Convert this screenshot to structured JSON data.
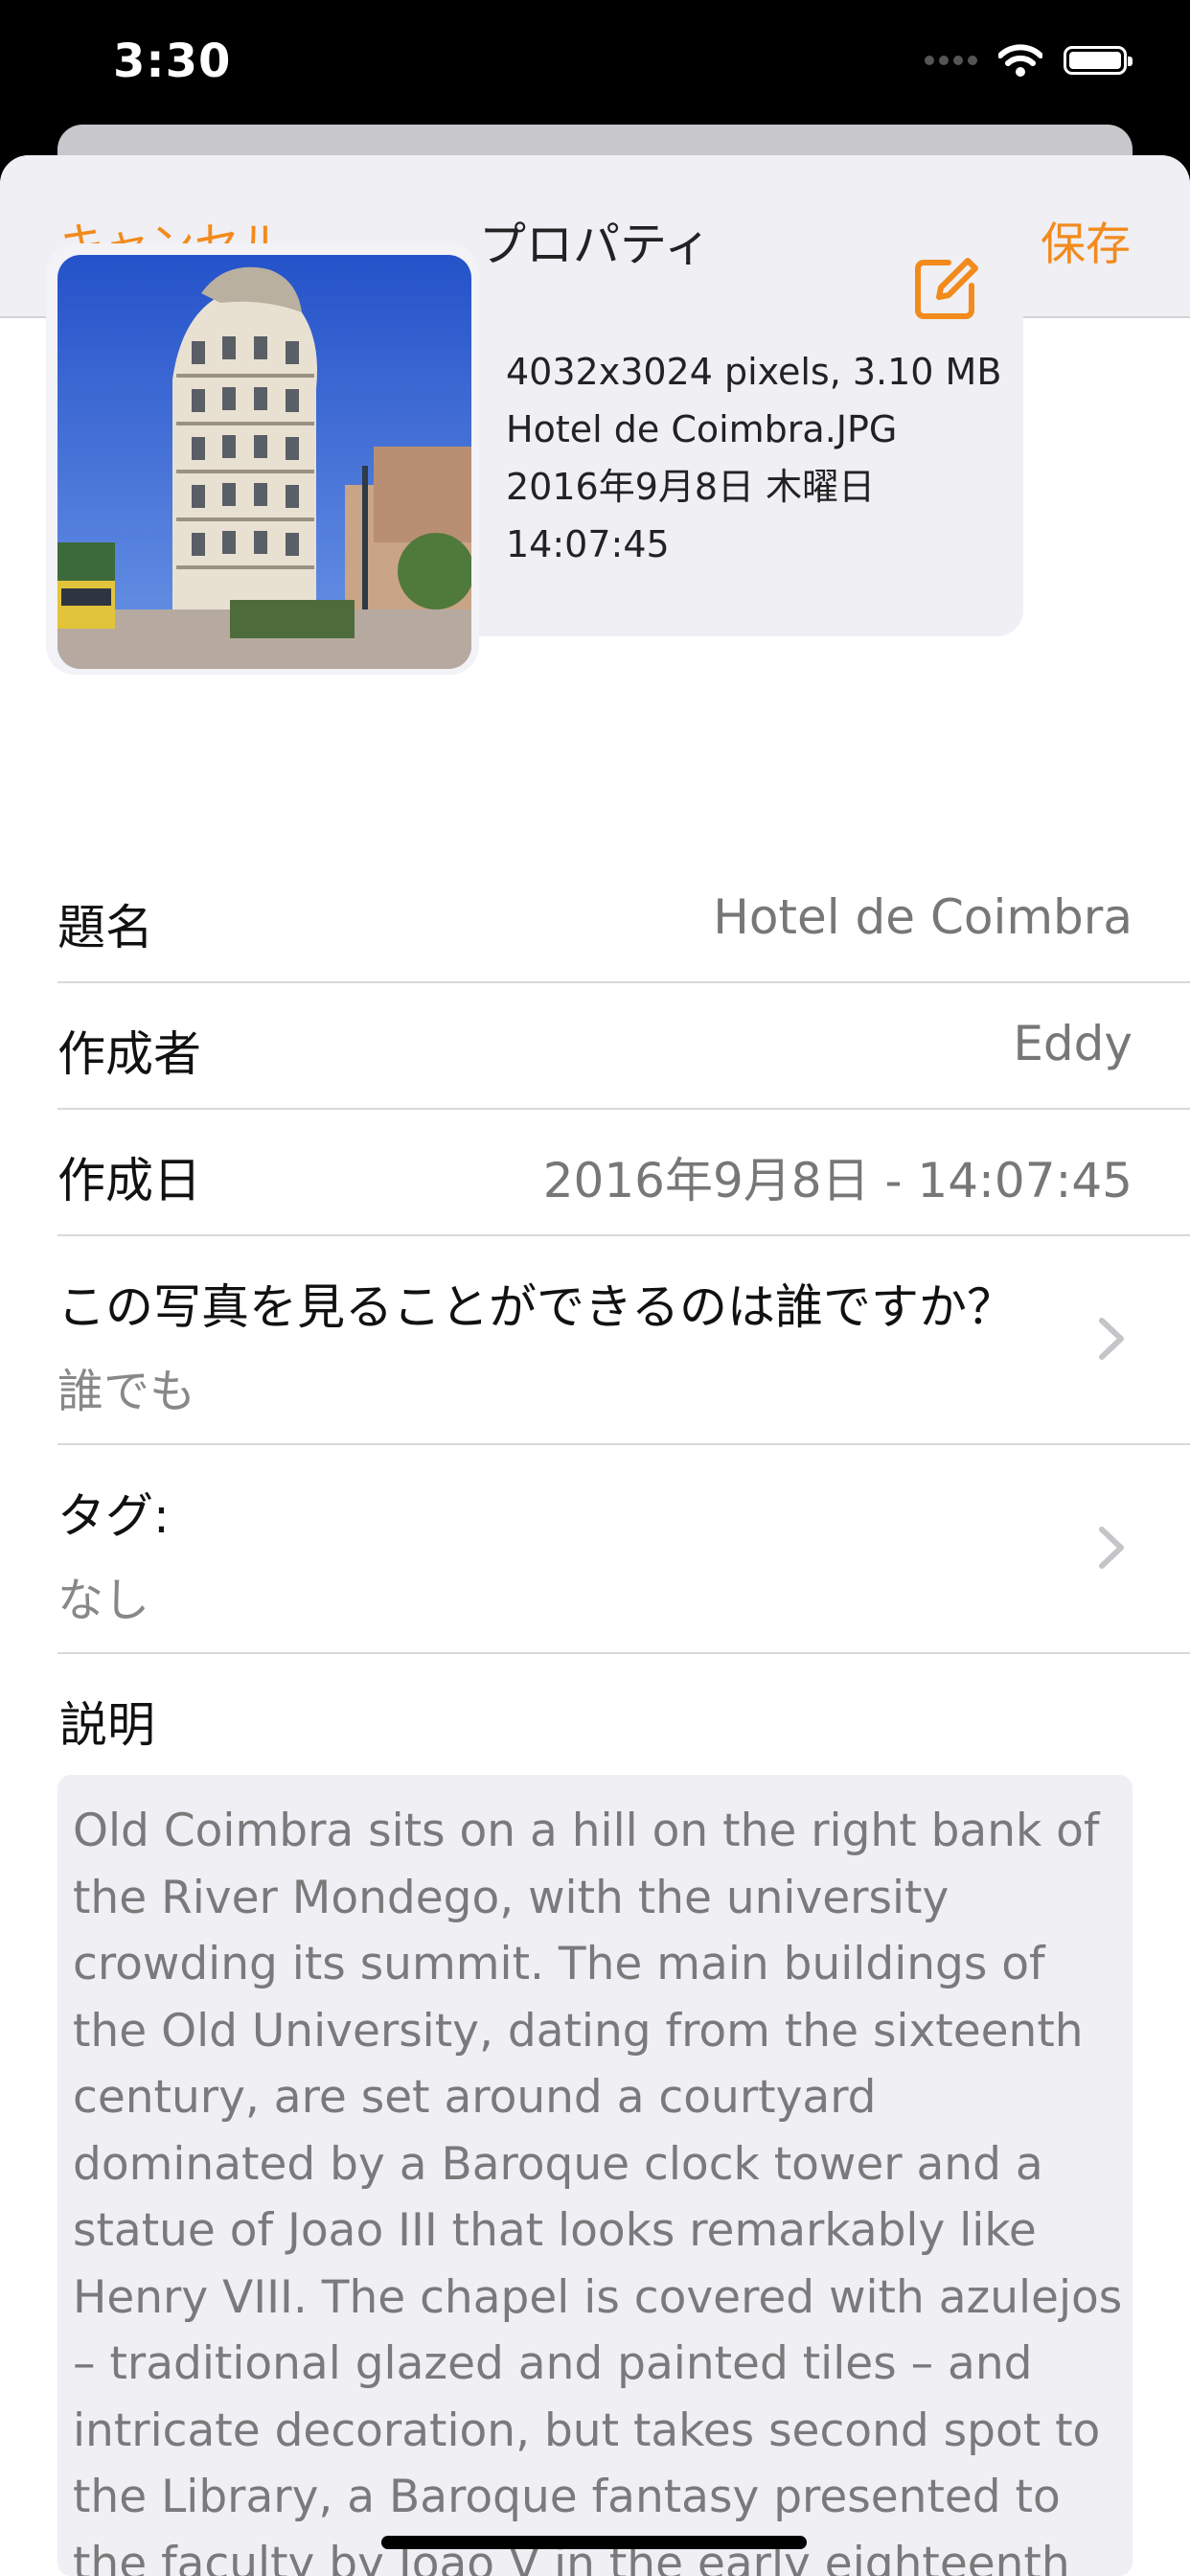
{
  "status_bar": {
    "time": "3:30",
    "icons": [
      "cellular-signal-icon",
      "wifi-icon",
      "battery-icon"
    ]
  },
  "nav": {
    "cancel": "キャンセル",
    "title": "プロパティ",
    "save": "保存",
    "accent_color": "#f28a1c"
  },
  "photo": {
    "description": "Hotel de Coimbra building photo",
    "info_lines": [
      "4032x3024 pixels, 3.10 MB",
      "Hotel de Coimbra.JPG",
      "2016年9月8日 木曜日",
      "14:07:45"
    ],
    "edit_icon": "edit-icon"
  },
  "fields": {
    "title": {
      "label": "題名",
      "value": "Hotel de Coimbra"
    },
    "author": {
      "label": "作成者",
      "value": "Eddy"
    },
    "date": {
      "label": "作成日",
      "value": "2016年9月8日 - 14:07:45"
    },
    "visibility": {
      "label": "この写真を見ることができるのは誰ですか？",
      "value": "誰でも"
    },
    "tags": {
      "label": "タグ:",
      "value": "なし"
    }
  },
  "description": {
    "label": "説明",
    "text": "Old Coimbra sits on a hill on the right bank of the River Mondego, with the university crowding its summit. The main buildings of the Old University, dating from the sixteenth century, are set around a courtyard dominated by a Baroque clock tower and a statue of Joao III that looks remarkably like Henry VIII. The chapel is covered with azulejos – traditional glazed and painted tiles – and intricate decoration, but takes second spot to the Library, a Baroque fantasy presented to the faculty by Joao V in the early eighteenth"
  }
}
